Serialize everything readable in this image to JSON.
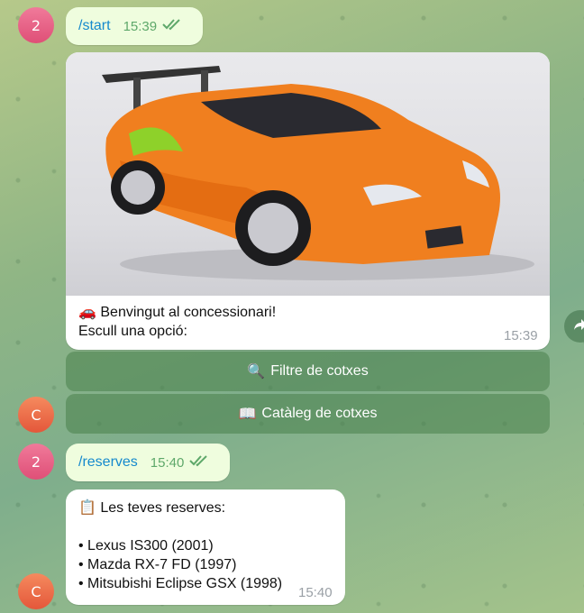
{
  "messages": {
    "start": {
      "avatar": "2",
      "command": "/start",
      "time": "15:39"
    },
    "welcome": {
      "avatar": "C",
      "line1": "🚗 Benvingut al concessionari!",
      "line2": "Escull una opció:",
      "time": "15:39",
      "image_icon": "orange-sports-car-photo"
    },
    "keyboard": [
      {
        "icon": "🔍",
        "label": "Filtre de cotxes"
      },
      {
        "icon": "📖",
        "label": "Catàleg de cotxes"
      }
    ],
    "reserves": {
      "avatar": "2",
      "command": "/reserves",
      "time": "15:40"
    },
    "reservations_reply": {
      "avatar": "C",
      "heading": "📋 Les teves reserves:",
      "items": [
        "• Lexus IS300 (2001)",
        "• Mazda RX-7 FD (1997)",
        "• Mitsubishi Eclipse GSX (1998)"
      ],
      "time": "15:40"
    }
  },
  "colors": {
    "outgoing_bubble": "#effdde",
    "command_link": "#168acd",
    "check_marks": "#5ea86a",
    "car_body": "#f07f1f"
  }
}
